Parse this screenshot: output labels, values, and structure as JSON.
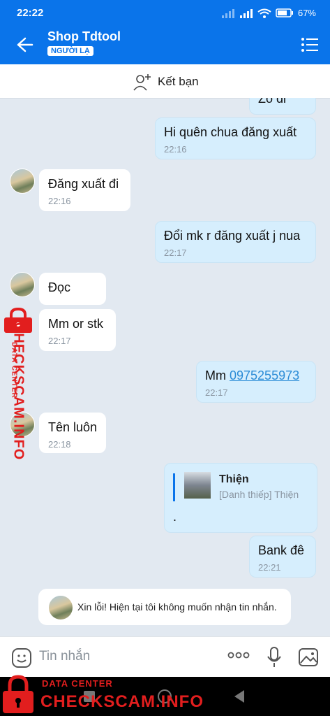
{
  "status": {
    "time": "22:22",
    "battery": "67%"
  },
  "header": {
    "title": "Shop Tdtool",
    "badge": "NGƯỜI LẠ"
  },
  "friend_bar": {
    "label": "Kết bạn"
  },
  "messages": [
    {
      "dir": "out",
      "text": "Zô đi",
      "time": ""
    },
    {
      "dir": "out",
      "text": "Hi quên chua đăng xuất",
      "time": "22:16"
    },
    {
      "dir": "in",
      "text": "Đăng xuất đi",
      "time": "22:16"
    },
    {
      "dir": "out",
      "text": "Đổi mk r đăng xuất j nua",
      "time": "22:17"
    },
    {
      "dir": "in",
      "text": "Đọc",
      "time": ""
    },
    {
      "dir": "in",
      "text": "Mm or stk",
      "time": "22:17"
    },
    {
      "dir": "out",
      "text_prefix": "Mm ",
      "link": "0975255973",
      "time": "22:17"
    },
    {
      "dir": "in",
      "text": "Tên luôn",
      "time": "22:18"
    },
    {
      "dir": "out",
      "text": "Bank đê",
      "time": "22:21"
    }
  ],
  "contact_card": {
    "name": "Thiện",
    "subtitle": "[Danh thiếp] Thiện",
    "body": "."
  },
  "notice": {
    "text": "Xin lỗi! Hiện tại tôi không muốn nhận tin nhắn."
  },
  "composer": {
    "placeholder": "Tin nhắn"
  },
  "watermark": {
    "top": "DATA CENTER",
    "main": "CHECKSCAM.INFO"
  },
  "colors": {
    "accent": "#0a74ea",
    "bubble_out": "#d6eefd",
    "watermark": "#e21e1e"
  }
}
